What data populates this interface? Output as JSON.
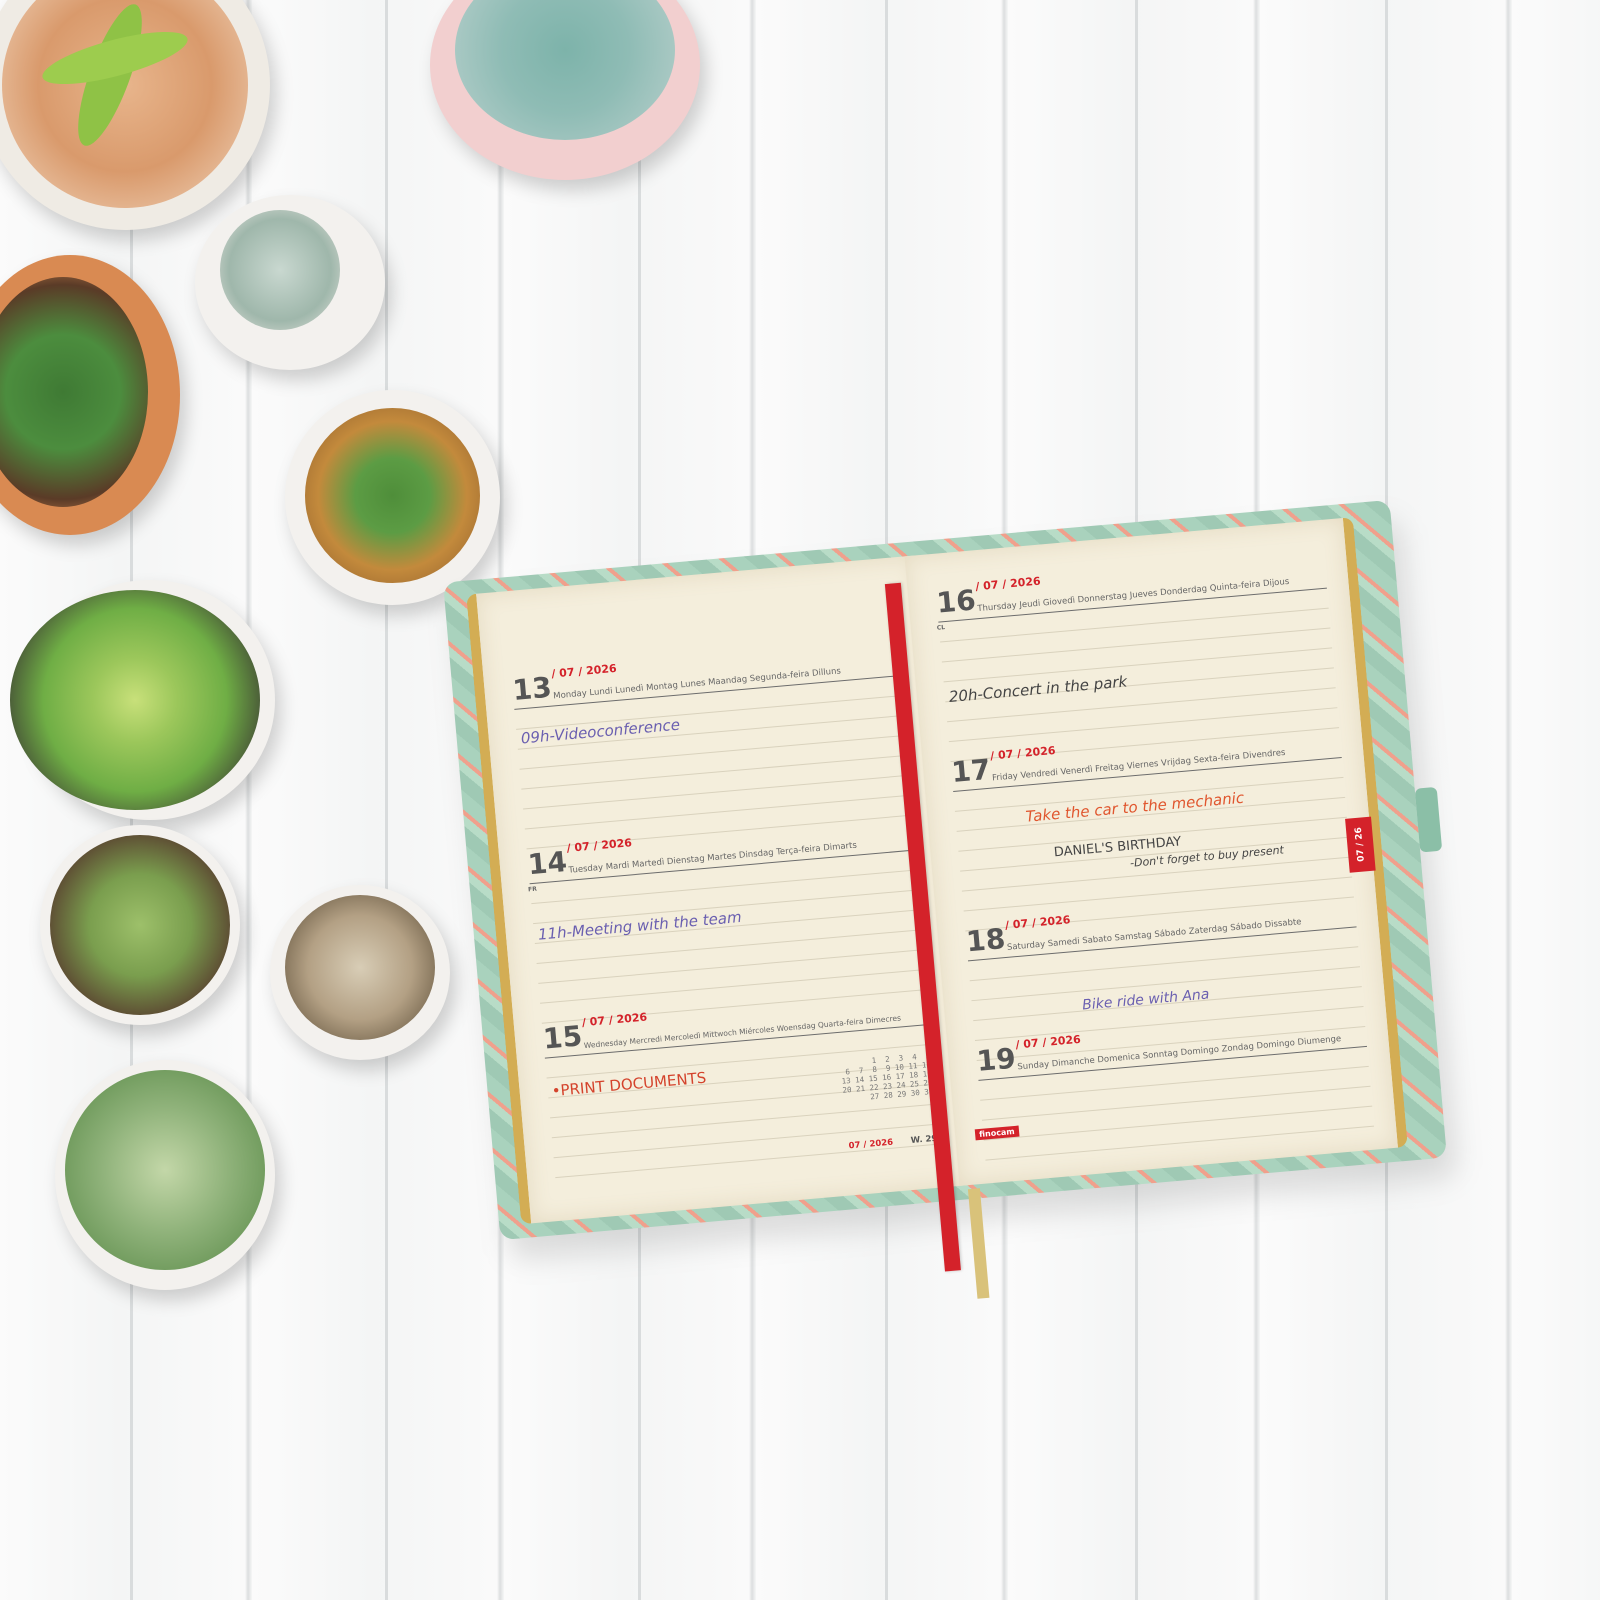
{
  "planner": {
    "left_page": {
      "days": [
        {
          "num": "13",
          "date": "/ 07 / 2026",
          "names": "Monday  Lundi  Lunedì  Montag  Lunes  Maandag  Segunda-feira  Dilluns",
          "note": "09h-Videoconference",
          "note_color": "#6a5fb0"
        },
        {
          "num": "14",
          "date": "/ 07 / 2026",
          "names": "Tuesday  Mardi  Martedì  Dienstag  Martes  Dinsdag  Terça-feira  Dimarts",
          "note": "11h-Meeting with the team",
          "note_color": "#6a5fb0"
        },
        {
          "num": "15",
          "date": "/ 07 / 2026",
          "names": "Wednesday  Mercredi  Mercoledì  Mittwoch  Miércoles  Woensdag  Quarta-feira  Dimecres",
          "note": "•PRINT DOCUMENTS",
          "note_color": "#d4432c"
        }
      ],
      "fr_mark": "FR",
      "mini_calendar": "       1  2  3  4  5\n 6  7  8  9 10 11 12\n13 14 15 16 17 18 19\n20 21 22 23 24 25 26\n27 28 29 30 31",
      "footer_month": "07 / 2026",
      "footer_week": "W. 29"
    },
    "right_page": {
      "days": [
        {
          "num": "16",
          "date": "/ 07 / 2026",
          "names": "Thursday  Jeudi  Giovedì  Donnerstag  Jueves  Donderdag  Quinta-feira  Dijous",
          "note": "20h-Concert in the park",
          "note_color": "#444444"
        },
        {
          "num": "17",
          "date": "/ 07 / 2026",
          "names": "Friday  Vendredi  Venerdì  Freitag  Viernes  Vrijdag  Sexta-feira  Divendres",
          "note": "Take the car to the mechanic",
          "note_color": "#e0562e",
          "note2": "DANIEL'S BIRTHDAY",
          "note3": "-Don't forget to buy present"
        },
        {
          "num": "18",
          "date": "/ 07 / 2026",
          "names": "Saturday  Samedi  Sabato  Samstag  Sábado  Zaterdag  Sábado  Dissabte",
          "note": "Bike ride with Ana",
          "note_color": "#6a5fb0"
        },
        {
          "num": "19",
          "date": "/ 07 / 2026",
          "names": "Sunday  Dimanche  Domenica  Sonntag  Domingo  Zondag  Domingo  Diumenge",
          "note": "",
          "note_color": "#6a5fb0"
        }
      ],
      "cl_mark": "CL",
      "brand": "finocam",
      "month_tab": "07 / 26"
    }
  },
  "colors": {
    "accent_red": "#d4222a",
    "paper": "#f4eedc",
    "gilt_edge": "#d3ad54",
    "cover_green": "#9fc9b4"
  }
}
